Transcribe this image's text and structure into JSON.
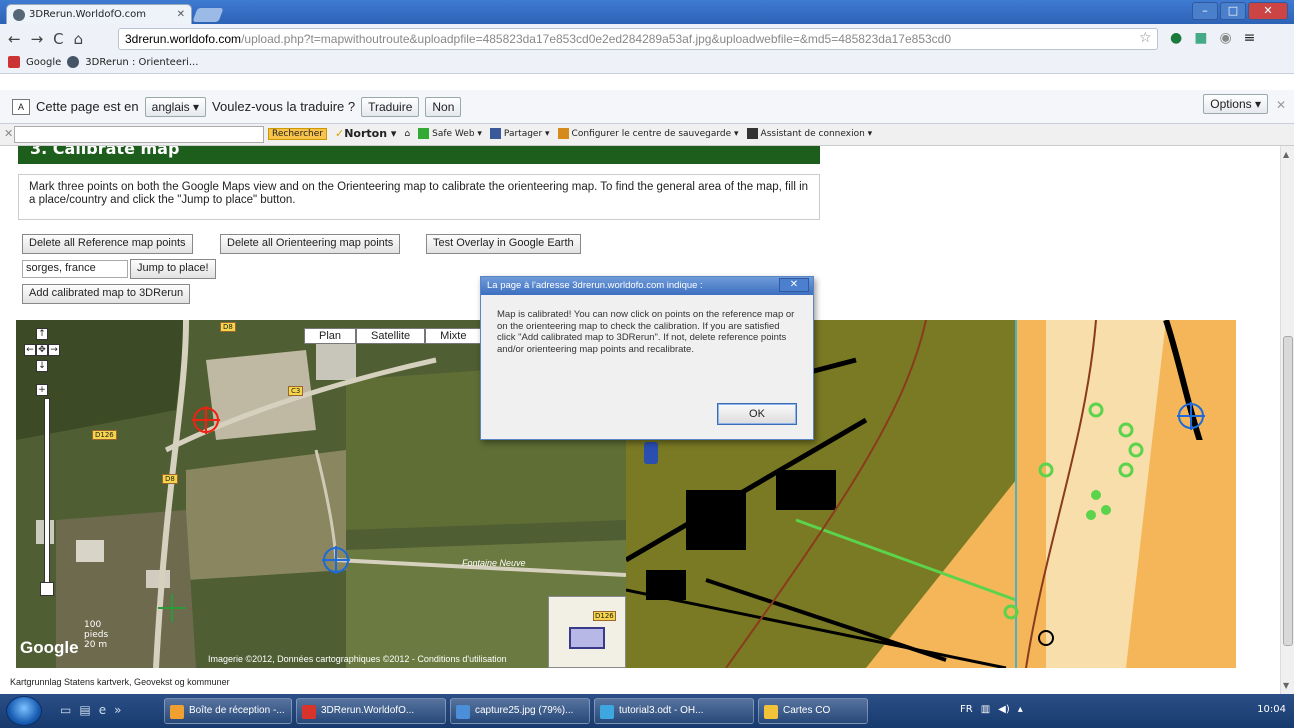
{
  "browser": {
    "tab_title": "3DRerun.WorldofO.com",
    "url_host": "3drerun.worldofo.com",
    "url_path": "/upload.php?t=mapwithoutroute&uploadpfile=485823da17e853cd0e2ed284289a53af.jpg&uploadwebfile=&md5=485823da17e853cd0",
    "bookmarks": [
      "Google",
      "3DRerun : Orienteeri..."
    ]
  },
  "translate_bar": {
    "text_prefix": "Cette page est en",
    "language": "anglais",
    "question": "Voulez-vous la traduire ?",
    "translate_btn": "Traduire",
    "no_btn": "Non",
    "options_btn": "Options"
  },
  "norton_bar": {
    "search_btn": "Rechercher",
    "brand": "Norton",
    "items": [
      "Safe Web",
      "Partager",
      "Configurer le centre de sauvegarde",
      "Assistant de connexion"
    ]
  },
  "page": {
    "heading": "3. Calibrate map",
    "instructions": "Mark three points on both the Google Maps view and on the Orienteering map to calibrate the orienteering map. To find the general area of the map, fill in a place/country and click the \"Jump to place\" button.",
    "btn_delete_ref": "Delete all Reference map points",
    "btn_delete_orient": "Delete all Orienteering map points",
    "btn_test_overlay": "Test Overlay in Google Earth",
    "place_value": "sorges, france",
    "btn_jump": "Jump to place!",
    "btn_add_map": "Add calibrated map to 3DRerun",
    "attribution": "Kartgrunnlag Statens kartverk, Geovekst og kommuner"
  },
  "google_map": {
    "map_types": [
      "Plan",
      "Satellite",
      "Mixte"
    ],
    "copyright": "Imagerie ©2012, Données cartographiques ©2012 - Conditions d'utilisation",
    "scale_top": "100",
    "scale_unit": "pieds",
    "scale_bottom": "20 m",
    "logo": "Google",
    "road_tags": [
      "D8",
      "C3",
      "D126",
      "D8",
      "D126"
    ],
    "place_label": "Fontaine Neuve"
  },
  "dialog": {
    "title": "La page à l'adresse 3drerun.worldofo.com indique :",
    "message": "Map is calibrated! You can now click on points on the reference map or on the orienteering map to check the calibration. If you are satisfied click \"Add calibrated map to 3DRerun\". If not, delete reference points and/or orienteering map points and recalibrate.",
    "ok": "OK"
  },
  "taskbar": {
    "items": [
      {
        "label": "Boîte de réception -...",
        "color": "#f0a030"
      },
      {
        "label": "3DRerun.WorldofO...",
        "color": "#d9342b"
      },
      {
        "label": "capture25.jpg (79%)...",
        "color": "#4a8fd8"
      },
      {
        "label": "tutorial3.odt - OH...",
        "color": "#3fa7e0"
      },
      {
        "label": "Cartes CO",
        "color": "#f2c23a"
      }
    ],
    "lang": "FR",
    "time": "10:04"
  },
  "colors": {
    "banner_green": "#1d5e1d",
    "olive": "#7a7a24",
    "yellow_open": "#f5b65a",
    "light_green": "#5bd34a"
  }
}
